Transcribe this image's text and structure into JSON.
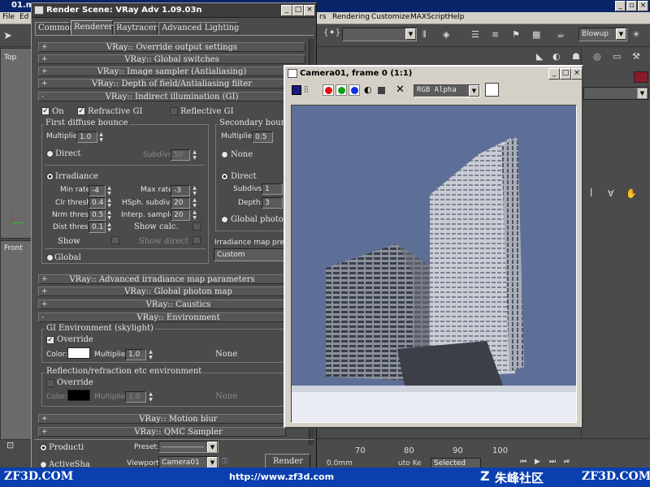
{
  "app": {
    "title": "01.m",
    "menus": [
      "File",
      "Ed"
    ],
    "menus_right": [
      "rs",
      "Rendering",
      "Customize",
      "MAXScript",
      "Help"
    ],
    "named_selection": "",
    "render_preset": "Blowup",
    "viewport_top": "Top",
    "viewport_front": "Front",
    "timeline_ticks": [
      "70",
      "80",
      "90",
      "100"
    ],
    "status_fields": [
      "0.0mm",
      "uto Ke",
      "Selected"
    ]
  },
  "render_dialog": {
    "title": "Render Scene: VRay Adv 1.09.03n",
    "tabs": [
      "Common",
      "Renderer",
      "Raytracer",
      "Advanced Lighting"
    ],
    "rollouts_top": [
      {
        "sym": "+",
        "title": "VRay:: Override output settings"
      },
      {
        "sym": "+",
        "title": "VRay:: Global switches"
      },
      {
        "sym": "+",
        "title": "VRay:: Image sampler (Antialiasing)"
      },
      {
        "sym": "+",
        "title": "VRay:: Depth of field/Antialiasing filter"
      },
      {
        "sym": "-",
        "title": "VRay:: Indirect illumination (GI)"
      }
    ],
    "gi": {
      "on_label": "On",
      "refractive_gi_label": "Refractive GI",
      "reflective_gi_label": "Reflective GI",
      "first_bounce_group": "First diffuse bounce",
      "multiplier_label": "Multiplier:",
      "multiplier_value": "1.0",
      "direct_label": "Direct",
      "subdivs_label": "Subdivs:",
      "subdivs_value": "50",
      "irradiance_label": "Irradiance",
      "min_rate_label": "Min rate:",
      "min_rate_value": "-4",
      "max_rate_label": "Max rate:",
      "max_rate_value": "-3",
      "clr_thresh_label": "Clr thresh:",
      "clr_thresh_value": "0.4",
      "hsph_subdivs_label": "HSph. subdivs:",
      "hsph_subdivs_value": "20",
      "nrm_thresh_label": "Nrm thresh:",
      "nrm_thresh_value": "0.5",
      "interp_samples_label": "Interp. samples:",
      "interp_samples_value": "20",
      "dist_thresh_label": "Dist thresh:",
      "dist_thresh_value": "0.1",
      "show_calc_label": "Show calc.",
      "show_label": "Show",
      "show_direct_label": "Show direct",
      "global_label": "Global",
      "second_bounce_group": "Secondary bounce",
      "second_multiplier_label": "Multiplier:",
      "second_multiplier_value": "0.5",
      "none_label": "None",
      "second_direct_label": "Direct",
      "second_subdivs_label": "Subdivs:",
      "second_subdivs_value": "1",
      "depth_label": "Depth:",
      "depth_value": "3",
      "global_photon_label": "Global photo",
      "irradiance_presets_label": "Irradiance map presets",
      "irradiance_presets_value": "Custom"
    },
    "rollouts_mid": [
      {
        "sym": "+",
        "title": "VRay:: Advanced irradiance map parameters"
      },
      {
        "sym": "+",
        "title": "VRay:: Global photon map"
      },
      {
        "sym": "+",
        "title": "VRay:: Caustics"
      },
      {
        "sym": "-",
        "title": "VRay:: Environment"
      }
    ],
    "environment": {
      "gi_env_group": "GI Environment (skylight)",
      "override_label": "Override",
      "color_label": "Color:",
      "multiplier_label": "Multiplier:",
      "multiplier_value": "1.0",
      "map_value": "None",
      "refl_group": "Reflection/refraction etc environment",
      "refl_override_label": "Override",
      "refl_color_label": "Color:",
      "refl_multiplier_label": "Multiplier:",
      "refl_multiplier_value": "1.0",
      "refl_map_value": "None"
    },
    "rollouts_bottom": [
      {
        "sym": "+",
        "title": "VRay:: Motion blur"
      },
      {
        "sym": "+",
        "title": "VRay:: QMC Sampler"
      }
    ],
    "footer": {
      "production_label": "Producti",
      "activeshade_label": "ActiveSha",
      "preset_label": "Preset:",
      "preset_value": "----------------",
      "viewport_label": "Viewport:",
      "viewport_value": "Camera01",
      "render_button": "Render"
    }
  },
  "frame_window": {
    "title": "Camera01, frame 0 (1:1)",
    "channel": "RGB Alpha",
    "channel_colors": [
      "#e01010",
      "#10a010",
      "#1030e0"
    ]
  },
  "watermark": {
    "left": "ZF3D.COM",
    "url": "http://www.zf3d.com",
    "chinese": "朱峰社区",
    "right": "ZF3D.COM"
  }
}
